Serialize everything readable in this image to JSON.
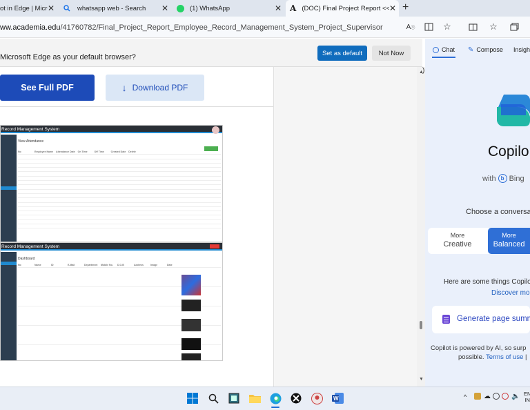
{
  "tabs": [
    {
      "title": "ot in Edge | Micro",
      "icon": "edge-favicon"
    },
    {
      "title": "whatsapp web - Search",
      "icon": "search-icon"
    },
    {
      "title": "(1) WhatsApp",
      "icon": "whatsapp-icon"
    },
    {
      "title": "(DOC) Final Project Report <<Em",
      "icon": "academia-icon"
    }
  ],
  "tab_close": "✕",
  "new_tab": "+",
  "address": {
    "host": "ww.academia.edu",
    "path": "/41760782/Final_Project_Report_Employee_Record_Management_System_Project_Supervisor"
  },
  "infobar": {
    "message": "Microsoft Edge as your default browser?",
    "set_default": "Set as default",
    "not_now": "Not Now"
  },
  "pdf": {
    "see_full": "See Full PDF",
    "download": "Download PDF"
  },
  "doc": {
    "ss1_title": "Record Management System",
    "ss1_heading": "View Attendance",
    "ss2_title": "Record Management System",
    "ss2_heading": "Dashboard",
    "ss1_columns": [
      "No",
      "Employee Name",
      "Attendance Date",
      "On Time",
      "Off Time",
      "Created Date",
      "Delete"
    ],
    "ss2_columns": [
      "No",
      "Name",
      "ID",
      "E-Mail",
      "Department",
      "Mobile No.",
      "D.O.B",
      "Address",
      "Image",
      "Date"
    ]
  },
  "sidebar": {
    "tab_chat": "Chat",
    "tab_compose": "Compose",
    "tab_insights": "Insight",
    "title": "Copilo",
    "with": "with",
    "bing": "Bing",
    "choose": "Choose a conversa",
    "tone_creative_top": "More",
    "tone_creative": "Creative",
    "tone_balanced_top": "More",
    "tone_balanced": "Balanced",
    "here": "Here are some things Copilo",
    "discover": "Discover mo",
    "generate": "Generate page summ",
    "powered_1": "Copilot is powered by AI, so surp",
    "powered_2a": "possible.",
    "powered_2b": "Terms of use",
    "powered_2c": "|"
  },
  "tray": {
    "lang": "EN",
    "lang2": "IN"
  },
  "colors": {
    "accent": "#0f6cbd",
    "pdf_blue": "#1d4bb8",
    "copilot_blue": "#2f6fd6"
  }
}
